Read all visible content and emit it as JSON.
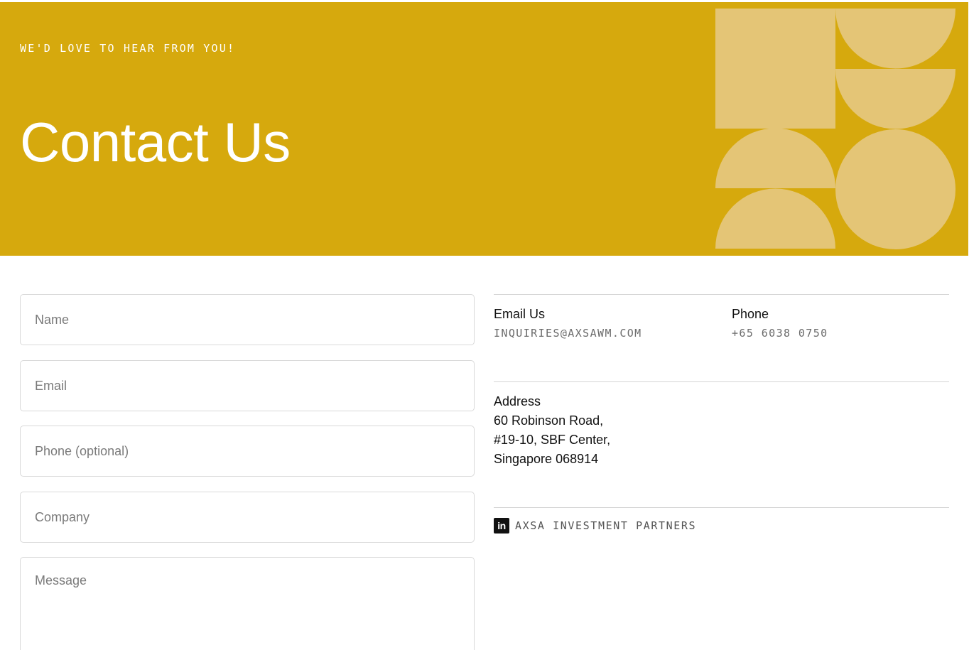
{
  "hero": {
    "eyebrow": "WE'D LOVE TO HEAR FROM YOU!",
    "title": "Contact Us",
    "background_color": "#d6a90d",
    "shape_color": "#e4c576"
  },
  "form": {
    "name_placeholder": "Name",
    "email_placeholder": "Email",
    "phone_placeholder": "Phone (optional)",
    "company_placeholder": "Company",
    "message_placeholder": "Message"
  },
  "contact": {
    "email_label": "Email Us",
    "email_value": "INQUIRIES@AXSAWM.COM",
    "phone_label": "Phone",
    "phone_value": "+65 6038 0750",
    "address_label": "Address",
    "address_lines": [
      "60 Robinson Road,",
      "#19-10, SBF Center,",
      "Singapore 068914"
    ],
    "linkedin_icon": "linkedin-icon",
    "linkedin_text": "AXSA INVESTMENT PARTNERS"
  }
}
